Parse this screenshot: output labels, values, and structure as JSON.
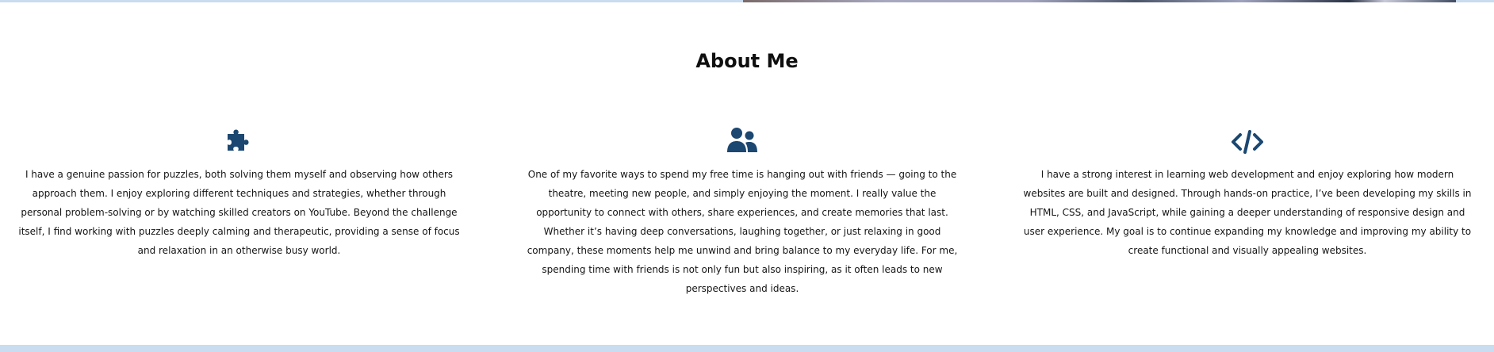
{
  "section": {
    "title": "About Me"
  },
  "features": [
    {
      "icon": "puzzle-piece-icon",
      "text": "I have a genuine passion for puzzles, both solving them myself and observing how others approach them. I enjoy exploring different techniques and strategies, whether through personal problem-solving or by watching skilled creators on YouTube. Beyond the challenge itself, I find working with puzzles deeply calming and therapeutic, providing a sense of focus and relaxation in an otherwise busy world."
    },
    {
      "icon": "users-icon",
      "text": "One of my favorite ways to spend my free time is hanging out with friends — going to the theatre, meeting new people, and simply enjoying the moment. I really value the opportunity to connect with others, share experiences, and create memories that last. Whether it’s having deep conversations, laughing together, or just relaxing in good company, these moments help me unwind and bring balance to my everyday life. For me, spending time with friends is not only fun but also inspiring, as it often leads to new perspectives and ideas."
    },
    {
      "icon": "code-icon",
      "text": "I have a strong interest in learning web development and enjoy exploring how modern websites are built and designed. Through hands-on practice, I’ve been developing my skills in HTML, CSS, and JavaScript, while gaining a deeper understanding of responsive design and user experience. My goal is to continue expanding my knowledge and improving my ability to create functional and visually appealing websites."
    }
  ],
  "colors": {
    "icon": "#1b4770",
    "band": "#c9dcf0",
    "background": "#ffffff"
  }
}
